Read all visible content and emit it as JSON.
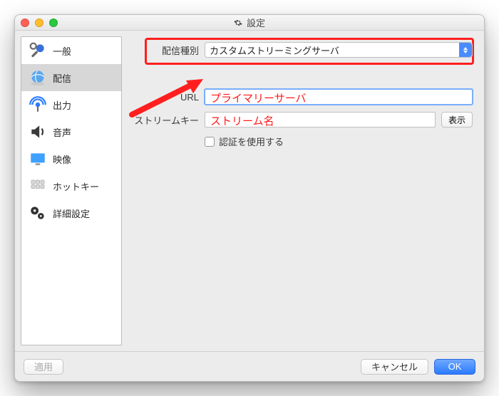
{
  "window": {
    "title": "設定"
  },
  "sidebar": {
    "items": [
      {
        "label": "一般"
      },
      {
        "label": "配信"
      },
      {
        "label": "出力"
      },
      {
        "label": "音声"
      },
      {
        "label": "映像"
      },
      {
        "label": "ホットキー"
      },
      {
        "label": "詳細設定"
      }
    ],
    "selected_index": 1
  },
  "form": {
    "type_label": "配信種別",
    "type_value": "カスタムストリーミングサーバ",
    "url_label": "URL",
    "url_value": "",
    "url_overlay": "プライマリーサーバ",
    "key_label": "ストリームキー",
    "key_value": "",
    "key_overlay": "ストリーム名",
    "show_button": "表示",
    "auth_label": "認証を使用する",
    "auth_checked": false
  },
  "footer": {
    "apply": "適用",
    "cancel": "キャンセル",
    "ok": "OK"
  }
}
